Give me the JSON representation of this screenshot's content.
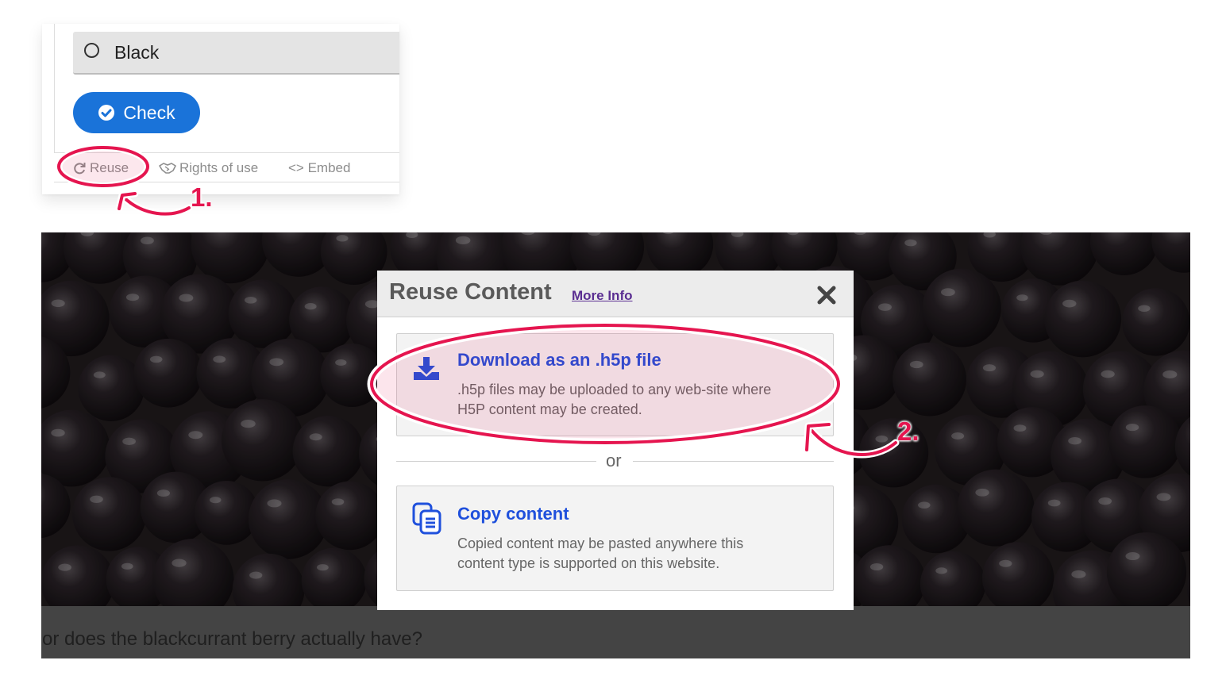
{
  "card": {
    "option_label": "Black",
    "check_label": "Check",
    "actions": {
      "reuse": "Reuse",
      "rights": "Rights of use",
      "embed": "<> Embed"
    }
  },
  "dialog": {
    "title": "Reuse Content",
    "more_info": "More Info",
    "download": {
      "title": "Download as an .h5p file",
      "desc_line1": ".h5p files may be uploaded to any web-site where",
      "desc_line2": "H5P content may be created."
    },
    "separator": "or",
    "copy": {
      "title": "Copy content",
      "desc_line1": "Copied content may be pasted anywhere this",
      "desc_line2": "content type is supported on this website."
    }
  },
  "caption": "or does the blackcurrant berry actually have?",
  "annotations": {
    "step1": "1.",
    "step2": "2."
  },
  "colors": {
    "accent_blue": "#1a73d9",
    "link_blue": "#1f50dc",
    "highlight": "#e5154f",
    "more_info": "#5a2d91"
  },
  "icons": [
    "check-circle-icon",
    "refresh-icon",
    "handshake-icon",
    "download-icon",
    "copy-icon",
    "close-icon"
  ]
}
